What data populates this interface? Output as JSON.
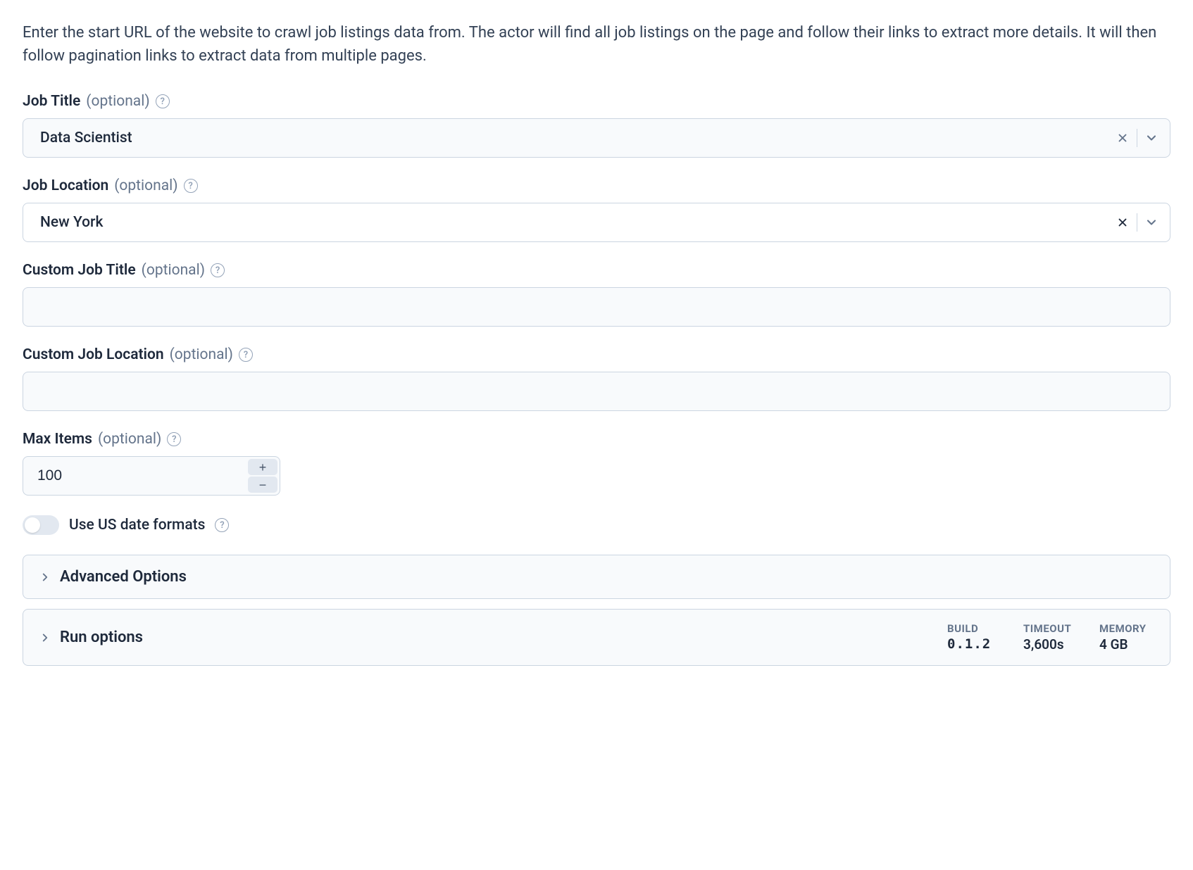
{
  "description": "Enter the start URL of the website to crawl job listings data from. The actor will find all job listings on the page and follow their links to extract more details. It will then follow pagination links to extract data from multiple pages.",
  "fields": {
    "jobTitle": {
      "label": "Job Title",
      "optional": "(optional)",
      "value": "Data Scientist"
    },
    "jobLocation": {
      "label": "Job Location",
      "optional": "(optional)",
      "value": "New York"
    },
    "customJobTitle": {
      "label": "Custom Job Title",
      "optional": "(optional)",
      "value": ""
    },
    "customJobLocation": {
      "label": "Custom Job Location",
      "optional": "(optional)",
      "value": ""
    },
    "maxItems": {
      "label": "Max Items",
      "optional": "(optional)",
      "value": "100"
    },
    "useUsDates": {
      "label": "Use US date formats",
      "value": false
    }
  },
  "collapsibles": {
    "advanced": "Advanced Options",
    "run": "Run options"
  },
  "runMeta": {
    "build": {
      "label": "BUILD",
      "value": "0.1.2"
    },
    "timeout": {
      "label": "TIMEOUT",
      "value": "3,600s"
    },
    "memory": {
      "label": "MEMORY",
      "value": "4 GB"
    }
  },
  "glyphs": {
    "help": "?",
    "plus": "+",
    "minus": "−"
  }
}
